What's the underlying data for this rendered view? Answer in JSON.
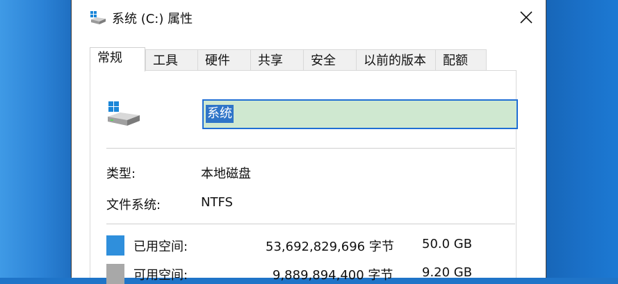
{
  "window": {
    "title": "系统 (C:) 属性",
    "close_glyph": "✕"
  },
  "tabs": [
    {
      "label": "常规",
      "active": true
    },
    {
      "label": "工具"
    },
    {
      "label": "硬件"
    },
    {
      "label": "共享"
    },
    {
      "label": "安全"
    },
    {
      "label": "以前的版本"
    },
    {
      "label": "配额"
    }
  ],
  "drive": {
    "icon": "drive-icon",
    "name_value": "系统"
  },
  "info": {
    "type_label": "类型:",
    "type_value": "本地磁盘",
    "fs_label": "文件系统:",
    "fs_value": "NTFS"
  },
  "space": {
    "used_label": "已用空间:",
    "used_bytes": "53,692,829,696 字节",
    "used_size": "50.0 GB",
    "used_color": "#2f8fdc",
    "free_label": "可用空间:",
    "free_bytes": "9,889,894,400 字节",
    "free_size": "9.20 GB",
    "free_color": "#a8a8a8"
  }
}
